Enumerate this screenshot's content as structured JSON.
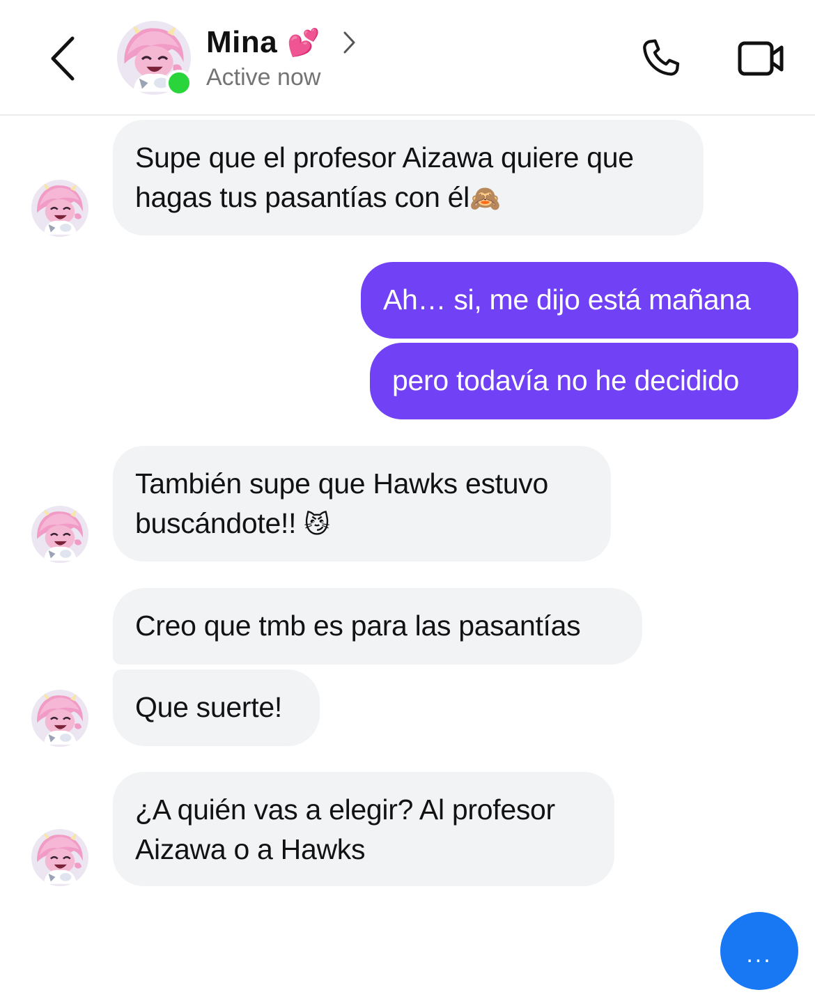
{
  "header": {
    "back_icon": "chevron-left-icon",
    "contact_name": "Mina",
    "name_emoji": "💕",
    "status": "Active now",
    "call_icon": "phone-icon",
    "video_icon": "video-camera-icon",
    "online_color": "#2ad43b"
  },
  "messages": [
    {
      "from": "contact",
      "lines": [
        "Supe que el profesor Aizawa quiere que",
        "hagas tus pasantías con él"
      ],
      "emoji": "🙈"
    },
    {
      "from": "me",
      "lines": [
        "Ah… si, me dijo está mañana"
      ]
    },
    {
      "from": "me",
      "lines": [
        "pero todavía no he decidido"
      ]
    },
    {
      "from": "contact",
      "lines": [
        "También supe que Hawks estuvo",
        "buscándote!!"
      ],
      "emoji": "😼"
    },
    {
      "from": "contact",
      "lines": [
        "Creo que tmb es para las pasantías"
      ]
    },
    {
      "from": "contact",
      "lines": [
        "Que suerte!"
      ]
    },
    {
      "from": "contact",
      "lines": [
        "¿A quién vas a elegir? Al profesor",
        "Aizawa o a Hawks"
      ]
    }
  ],
  "fab": {
    "label": "...",
    "icon": "more-dots-icon"
  },
  "colors": {
    "outgoing_bubble": "#7141f6",
    "incoming_bubble": "#f1f3f5",
    "fab": "#1877f2",
    "status_text": "#737373"
  }
}
